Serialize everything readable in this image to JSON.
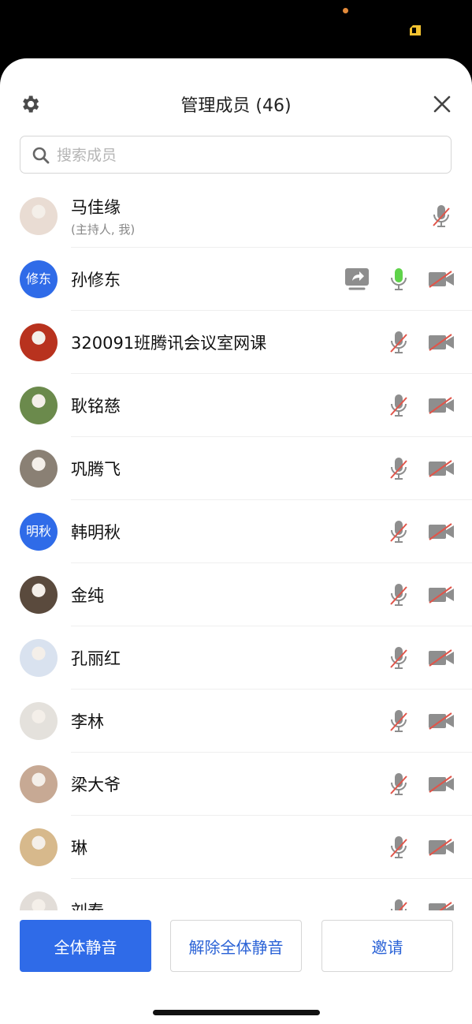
{
  "header": {
    "title": "管理成员 (46)"
  },
  "search": {
    "placeholder": "搜索成员"
  },
  "members": [
    {
      "name": "马佳缘",
      "subtitle": "(主持人, 我)",
      "avatar_type": "photo",
      "avatar_bg": "#e9dcd3",
      "mic": "muted",
      "camera": "none",
      "sharing": false
    },
    {
      "name": "孙修东",
      "avatar_type": "text",
      "avatar_text": "修东",
      "mic": "active",
      "camera": "off",
      "sharing": true
    },
    {
      "name": "320091班腾讯会议室网课",
      "avatar_type": "photo",
      "avatar_bg": "#b8321e",
      "mic": "muted",
      "camera": "off",
      "sharing": false
    },
    {
      "name": "耿铭慈",
      "avatar_type": "photo",
      "avatar_bg": "#6b8a4c",
      "mic": "muted",
      "camera": "off",
      "sharing": false
    },
    {
      "name": "巩腾飞",
      "avatar_type": "photo",
      "avatar_bg": "#8a8074",
      "mic": "muted",
      "camera": "off",
      "sharing": false
    },
    {
      "name": "韩明秋",
      "avatar_type": "text",
      "avatar_text": "明秋",
      "mic": "muted",
      "camera": "off",
      "sharing": false
    },
    {
      "name": "金纯",
      "avatar_type": "photo",
      "avatar_bg": "#5a4a3d",
      "mic": "muted",
      "camera": "off",
      "sharing": false
    },
    {
      "name": "孔丽红",
      "avatar_type": "photo",
      "avatar_bg": "#d9e2ef",
      "mic": "muted",
      "camera": "off",
      "sharing": false
    },
    {
      "name": "李林",
      "avatar_type": "photo",
      "avatar_bg": "#e4e1dc",
      "mic": "muted",
      "camera": "off",
      "sharing": false
    },
    {
      "name": "梁大爷",
      "avatar_type": "photo",
      "avatar_bg": "#c7a994",
      "mic": "muted",
      "camera": "off",
      "sharing": false
    },
    {
      "name": "琳",
      "avatar_type": "photo",
      "avatar_bg": "#d7b98c",
      "mic": "muted",
      "camera": "off",
      "sharing": false
    },
    {
      "name": "刘春",
      "avatar_type": "photo",
      "avatar_bg": "#e2ddd8",
      "mic": "muted",
      "camera": "off",
      "sharing": false
    }
  ],
  "actions": {
    "mute_all": "全体静音",
    "unmute_all": "解除全体静音",
    "invite": "邀请"
  },
  "colors": {
    "accent": "#2f6be8",
    "mic_active": "#5fd34a",
    "muted_slash": "#e0554a",
    "icon_gray": "#8e8e8e"
  }
}
